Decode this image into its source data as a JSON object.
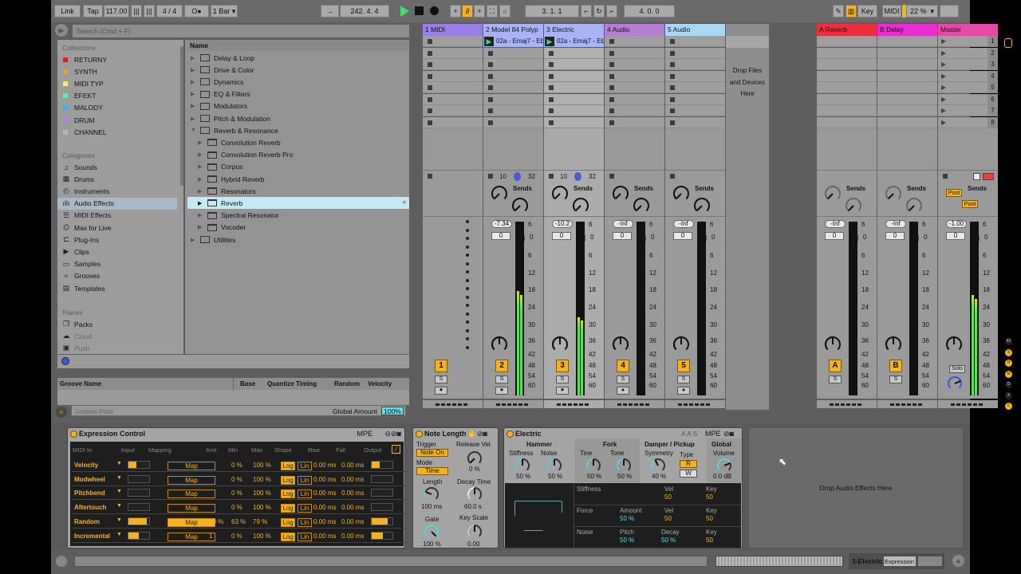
{
  "transport": {
    "link": "Link",
    "tap": "Tap",
    "tempo": "117.00",
    "signature": "4 / 4",
    "metronome": "O●",
    "quantize": "1 Bar",
    "position": "242.  4.  4",
    "loop_start": "3.  1.  1",
    "loop_length": "4.  0.  0",
    "key": "Key",
    "midi": "MIDI",
    "cpu": "22 %"
  },
  "browser": {
    "search_placeholder": "Search (Cmd + F)",
    "collections_title": "Collections",
    "collections": [
      {
        "label": "RETURNY",
        "color": "#e0201c"
      },
      {
        "label": "SYNTH",
        "color": "#f09a3a"
      },
      {
        "label": "MIDI TYP",
        "color": "#f2f05a"
      },
      {
        "label": "EFEKT",
        "color": "#5ef0b0"
      },
      {
        "label": "MALODY",
        "color": "#3ab0f0"
      },
      {
        "label": "DRUM",
        "color": "#b07af0"
      },
      {
        "label": "CHANNEL",
        "color": "#b8b8b8"
      }
    ],
    "categories_title": "Categories",
    "categories": [
      {
        "label": "Sounds",
        "icon": "♫"
      },
      {
        "label": "Drums",
        "icon": "▦"
      },
      {
        "label": "Instruments",
        "icon": "◴"
      },
      {
        "label": "Audio Effects",
        "icon": "ıllı"
      },
      {
        "label": "MIDI Effects",
        "icon": "☰"
      },
      {
        "label": "Max for Live",
        "icon": "⌬"
      },
      {
        "label": "Plug-Ins",
        "icon": "⊏"
      },
      {
        "label": "Clips",
        "icon": "▶"
      },
      {
        "label": "Samples",
        "icon": "▭"
      },
      {
        "label": "Grooves",
        "icon": "≈"
      },
      {
        "label": "Templates",
        "icon": "▤"
      }
    ],
    "places_title": "Places",
    "places": [
      {
        "label": "Packs",
        "icon": "❐"
      },
      {
        "label": "Cloud",
        "icon": "☁"
      },
      {
        "label": "Push",
        "icon": "▣"
      }
    ],
    "column_header": "Name",
    "items": [
      {
        "label": "Delay & Loop",
        "level": 0,
        "type": "folder"
      },
      {
        "label": "Drive & Color",
        "level": 0,
        "type": "folder"
      },
      {
        "label": "Dynamics",
        "level": 0,
        "type": "folder"
      },
      {
        "label": "EQ & Filters",
        "level": 0,
        "type": "folder"
      },
      {
        "label": "Modulators",
        "level": 0,
        "type": "folder"
      },
      {
        "label": "Pitch & Modulation",
        "level": 0,
        "type": "folder"
      },
      {
        "label": "Reverb & Resonance",
        "level": 0,
        "type": "folder-open"
      },
      {
        "label": "Convolution Reverb",
        "level": 1,
        "type": "device"
      },
      {
        "label": "Convolution Reverb Pro",
        "level": 1,
        "type": "device"
      },
      {
        "label": "Corpus",
        "level": 1,
        "type": "device"
      },
      {
        "label": "Hybrid Reverb",
        "level": 1,
        "type": "device"
      },
      {
        "label": "Resonators",
        "level": 1,
        "type": "device"
      },
      {
        "label": "Reverb",
        "level": 1,
        "type": "device",
        "selected": true
      },
      {
        "label": "Spectral Resonator",
        "level": 1,
        "type": "device"
      },
      {
        "label": "Vocoder",
        "level": 1,
        "type": "device"
      },
      {
        "label": "Utilities",
        "level": 0,
        "type": "folder"
      }
    ]
  },
  "groove_pool": {
    "columns": [
      "Groove Name",
      "Base",
      "Quantize",
      "Timing",
      "Random",
      "Velocity"
    ],
    "title": "Groove Pool",
    "global_amount_label": "Global Amount",
    "global_amount": "100%"
  },
  "session": {
    "drop_text": "Drop Files and Devices Here",
    "sends_label": "Sends",
    "scale": [
      "6",
      "0",
      "6",
      "12",
      "18",
      "24",
      "30",
      "36",
      "42",
      "48",
      "54",
      "60"
    ],
    "scene_numbers": [
      "1",
      "2",
      "3",
      "4",
      "5",
      "6",
      "7",
      "8"
    ],
    "tracks": [
      {
        "name": "1 MIDI",
        "color": "#9a7ee6",
        "number": "1",
        "clip": null,
        "type": "midi"
      },
      {
        "name": "2 Model 84 Polyp",
        "color": "#a8b2f4",
        "number": "2",
        "clip": "02a - Emaj7 - Eb",
        "io_in": "10",
        "io_out": "32",
        "volume": "-7.34",
        "pan": "0",
        "meter": 0.6
      },
      {
        "name": "3 Electric",
        "color": "#a8b2f4",
        "number": "3",
        "clip": "02a - Emaj7 - Eb",
        "io_in": "10",
        "io_out": "32",
        "volume": "-10.2",
        "pan": "0",
        "meter": 0.45,
        "selected": true
      },
      {
        "name": "4 Audio",
        "color": "#b57ed2",
        "number": "4",
        "clip": null,
        "volume": "-Inf",
        "pan": "0",
        "meter": 0
      },
      {
        "name": "5 Audio",
        "color": "#a8d8f6",
        "number": "5",
        "clip": null,
        "volume": "-Inf",
        "pan": "0",
        "meter": 0
      }
    ],
    "returns": [
      {
        "name": "A Reverb",
        "color": "#ee2e3c",
        "number": "A",
        "volume": "-Inf",
        "pan": "0",
        "meter": 0
      },
      {
        "name": "B Delay",
        "color": "#e82ed0",
        "number": "B",
        "volume": "-Inf",
        "pan": "0",
        "meter": 0
      }
    ],
    "master": {
      "name": "Master",
      "color": "#e64aa8",
      "volume": "-1.00",
      "pan": "0",
      "meter": 0.58,
      "post": "Post",
      "solo": "Solo"
    }
  },
  "devices": {
    "expression_control": {
      "title": "Expression Control",
      "mpe": "MPE",
      "headers": [
        "MIDI In",
        "Input",
        "Mapping",
        "Amt",
        "Min",
        "Max",
        "Shape",
        "Rise",
        "Fall",
        "Output"
      ],
      "map_label": "Map",
      "log_label": "Log",
      "lin_label": "Lin",
      "rows": [
        {
          "name": "Velocity",
          "input": 0.4,
          "amt": "",
          "min": "0 %",
          "max": "100 %",
          "rise": "0.00 ms",
          "fall": "0.00 ms",
          "output": 0.4,
          "mapped": false
        },
        {
          "name": "Modwheel",
          "input": 0,
          "amt": "",
          "min": "0 %",
          "max": "100 %",
          "rise": "0.00 ms",
          "fall": "0.00 ms",
          "output": 0,
          "mapped": false
        },
        {
          "name": "Pitchbend",
          "input": 0,
          "amt": "",
          "min": "0 %",
          "max": "100 %",
          "rise": "0.00 ms",
          "fall": "0.00 ms",
          "output": 0,
          "mapped": false
        },
        {
          "name": "Aftertouch",
          "input": 0,
          "amt": "",
          "min": "0 %",
          "max": "100 %",
          "rise": "0.00 ms",
          "fall": "0.00 ms",
          "output": 0,
          "mapped": false
        },
        {
          "name": "Random",
          "input": 0.87,
          "amt": "50 %",
          "min": "63 %",
          "max": "79 %",
          "rise": "0.00 ms",
          "fall": "0.00 ms",
          "output": 0.78,
          "mapped": true
        },
        {
          "name": "Incremental",
          "input": 0.5,
          "amt": "1",
          "min": "0 %",
          "max": "100 %",
          "rise": "0.00 ms",
          "fall": "0.00 ms",
          "output": 0.55,
          "mapped": false
        }
      ]
    },
    "note_length": {
      "title": "Note Length",
      "trigger_label": "Trigger",
      "trigger_value": "Note On",
      "mode_label": "Mode",
      "mode_value": "Time",
      "release_vel_label": "Release Vel.",
      "release_vel": "0 %",
      "length_label": "Length",
      "length": "100 ms",
      "decay_label": "Decay Time",
      "decay": "60.0 s",
      "gate_label": "Gate",
      "gate": "100 %",
      "keyscale_label": "Key Scale",
      "keyscale": "0.00"
    },
    "electric": {
      "title": "Electric",
      "flags": "A A S",
      "mpe": "MPE",
      "hammer": "Hammer",
      "fork": "Fork",
      "damper": "Damper / Pickup",
      "global": "Global",
      "stiffness_label": "Stiffness",
      "stiffness": "50 %",
      "noise_label": "Noise",
      "noise": "50 %",
      "tine_label": "Tine",
      "tine": "50 %",
      "tone_label": "Tone",
      "tone": "50 %",
      "symmetry_label": "Symmetry",
      "symmetry": "40 %",
      "type_label": "Type",
      "type_r": "R",
      "type_w": "W",
      "volume_label": "Volume",
      "volume": "0.0 dB",
      "mod": {
        "stiffness": "Stiffness",
        "force": "Force",
        "noise": "Noise",
        "vel": "Vel",
        "key": "Key",
        "amount": "Amount",
        "pitch": "Pitch",
        "decay": "Decay",
        "stiff_vel": "50",
        "stiff_key": "50",
        "force_amount": "50 %",
        "force_vel": "50",
        "force_key": "50",
        "noise_pitch": "50 %",
        "noise_decay": "50 %",
        "noise_key": "50"
      }
    },
    "drop_text": "Drop Audio Effects Here"
  },
  "status": {
    "track": "3-Electric",
    "device": "Expression"
  }
}
